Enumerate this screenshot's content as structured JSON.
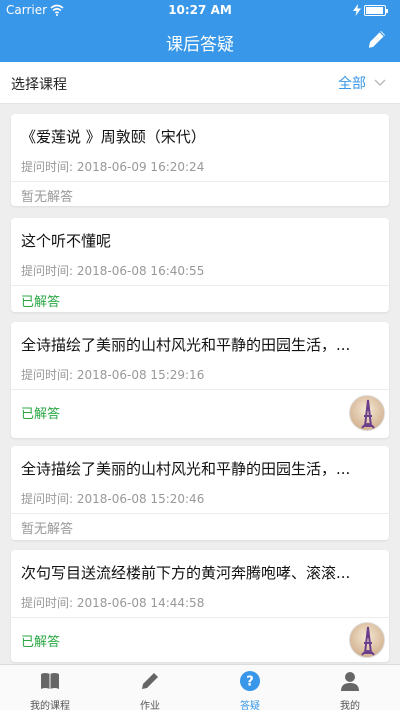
{
  "status_bar": {
    "carrier": "Carrier",
    "time": "10:27 AM"
  },
  "navbar": {
    "title": "课后答疑",
    "edit_icon": "pencil-icon"
  },
  "filter": {
    "label": "选择课程",
    "value": "全部"
  },
  "colors": {
    "primary": "#3897e8",
    "answered": "#2aa844",
    "unanswered": "#999999"
  },
  "questions": [
    {
      "title": "《爱莲说 》周敦颐（宋代）",
      "time_label": "提问时间:",
      "time": "2018-06-09 16:20:24",
      "status": "暂无解答",
      "answered": false,
      "has_avatar": false
    },
    {
      "title": "这个听不懂呢",
      "time_label": "提问时间:",
      "time": "2018-06-08 16:40:55",
      "status": "已解答",
      "answered": true,
      "has_avatar": false
    },
    {
      "title": "全诗描绘了美丽的山村风光和平静的田园生活，...",
      "time_label": "提问时间:",
      "time": "2018-06-08 15:29:16",
      "status": "已解答",
      "answered": true,
      "has_avatar": true
    },
    {
      "title": "全诗描绘了美丽的山村风光和平静的田园生活，...",
      "time_label": "提问时间:",
      "time": "2018-06-08 15:20:46",
      "status": "暂无解答",
      "answered": false,
      "has_avatar": false
    },
    {
      "title": "次句写目送流经楼前下方的黄河奔腾咆哮、滚滚...",
      "time_label": "提问时间:",
      "time": "2018-06-08 14:44:58",
      "status": "已解答",
      "answered": true,
      "has_avatar": true
    }
  ],
  "tabs": [
    {
      "label": "我的课程",
      "icon": "book-icon",
      "active": false
    },
    {
      "label": "作业",
      "icon": "pencil-icon",
      "active": false
    },
    {
      "label": "答疑",
      "icon": "question-icon",
      "active": true
    },
    {
      "label": "我的",
      "icon": "person-icon",
      "active": false
    }
  ]
}
